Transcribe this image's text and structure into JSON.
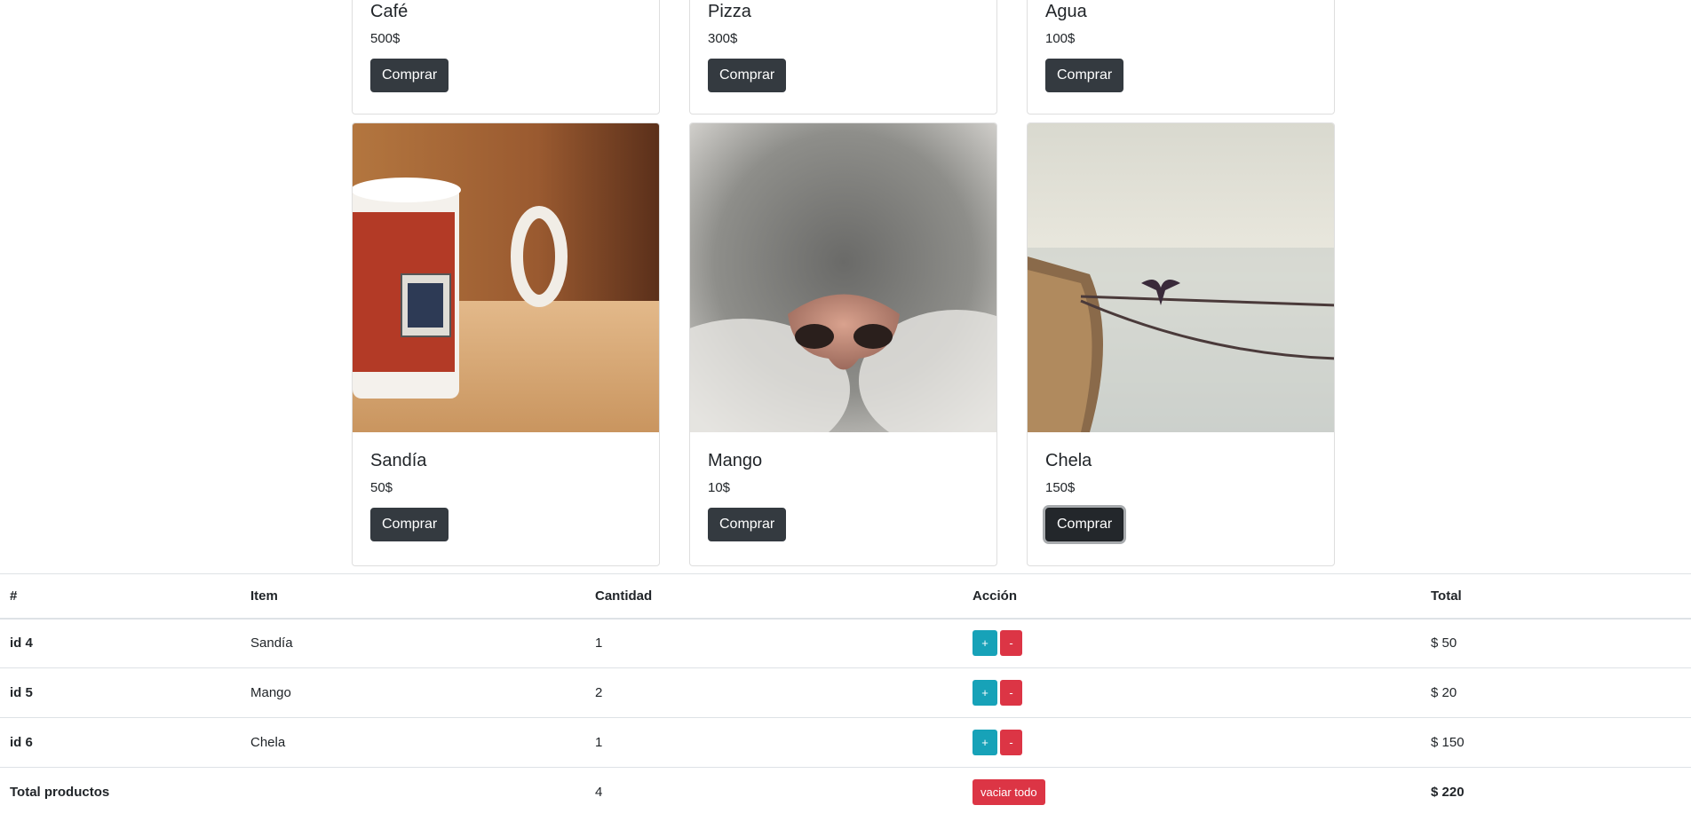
{
  "products_top": [
    {
      "name": "Café",
      "price": "500$",
      "button": "Comprar"
    },
    {
      "name": "Pizza",
      "price": "300$",
      "button": "Comprar"
    },
    {
      "name": "Agua",
      "price": "100$",
      "button": "Comprar"
    }
  ],
  "products_bottom": [
    {
      "name": "Sandía",
      "price": "50$",
      "button": "Comprar",
      "image": "coffee-mug-photo"
    },
    {
      "name": "Mango",
      "price": "10$",
      "button": "Comprar",
      "image": "cat-nose-photo"
    },
    {
      "name": "Chela",
      "price": "150$",
      "button": "Comprar",
      "image": "boat-bird-photo"
    }
  ],
  "cart": {
    "headers": [
      "#",
      "Item",
      "Cantidad",
      "Acción",
      "Total"
    ],
    "rows": [
      {
        "id": "id 4",
        "item": "Sandía",
        "qty": "1",
        "plus": "+",
        "minus": "-",
        "total": "$ 50"
      },
      {
        "id": "id 5",
        "item": "Mango",
        "qty": "2",
        "plus": "+",
        "minus": "-",
        "total": "$ 20"
      },
      {
        "id": "id 6",
        "item": "Chela",
        "qty": "1",
        "plus": "+",
        "minus": "-",
        "total": "$ 150"
      }
    ],
    "footer": {
      "label": "Total productos",
      "qty": "4",
      "clear_button": "vaciar todo",
      "total": "$ 220"
    }
  },
  "colors": {
    "dark_button": "#343a40",
    "info": "#17a2b8",
    "danger": "#dc3545"
  }
}
